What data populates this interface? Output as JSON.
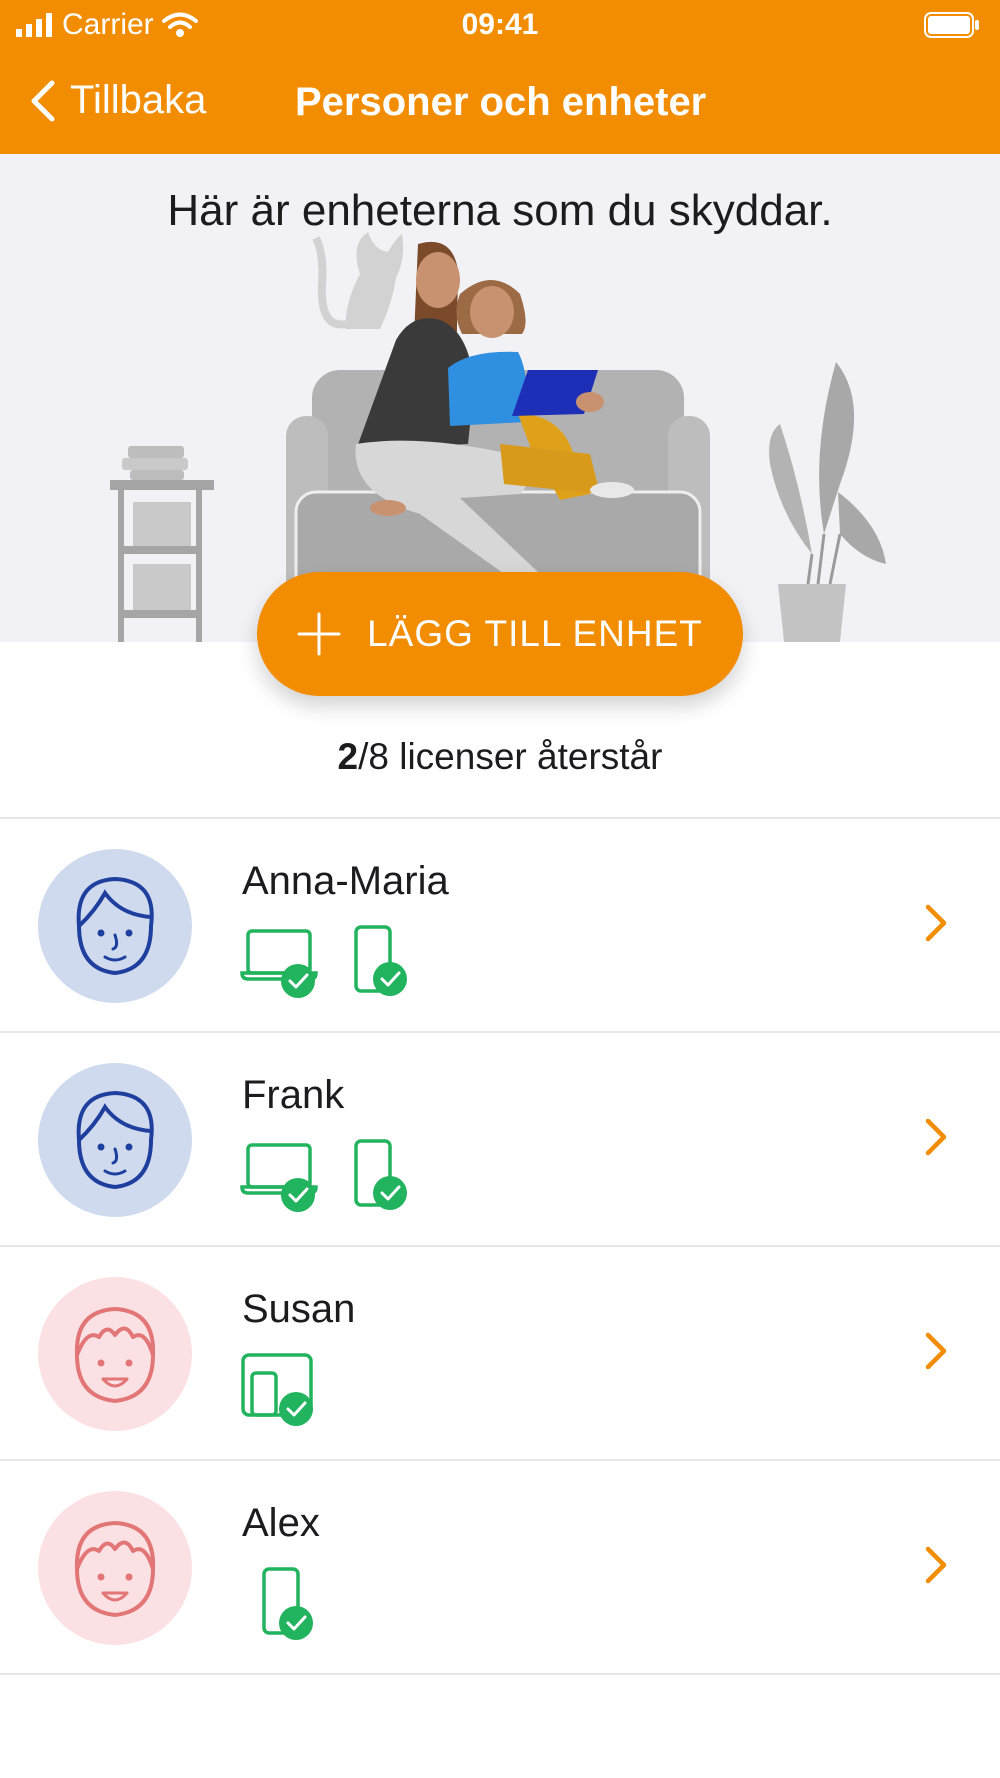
{
  "status_bar": {
    "carrier": "Carrier",
    "time": "09:41"
  },
  "nav": {
    "back_label": "Tillbaka",
    "title": "Personer och enheter"
  },
  "hero": {
    "title": "Här är enheterna som du skyddar."
  },
  "add_button": {
    "label": "LÄGG TILL ENHET"
  },
  "licenses": {
    "remaining": "2",
    "total_text": "/8 licenser återstår"
  },
  "people": [
    {
      "name": "Anna-Maria",
      "avatar": "adult-face-icon",
      "devices": [
        "laptop",
        "phone"
      ]
    },
    {
      "name": "Frank",
      "avatar": "adult-face-icon",
      "devices": [
        "laptop",
        "phone"
      ]
    },
    {
      "name": "Susan",
      "avatar": "child-face-icon",
      "devices": [
        "tablet"
      ]
    },
    {
      "name": "Alex",
      "avatar": "child-face-icon",
      "devices": [
        "phone"
      ]
    }
  ],
  "colors": {
    "accent": "#F28C00",
    "device_ok": "#22B35E",
    "adult_avatar_bg": "#CFDAEE",
    "child_avatar_bg": "#FCE1E4"
  }
}
